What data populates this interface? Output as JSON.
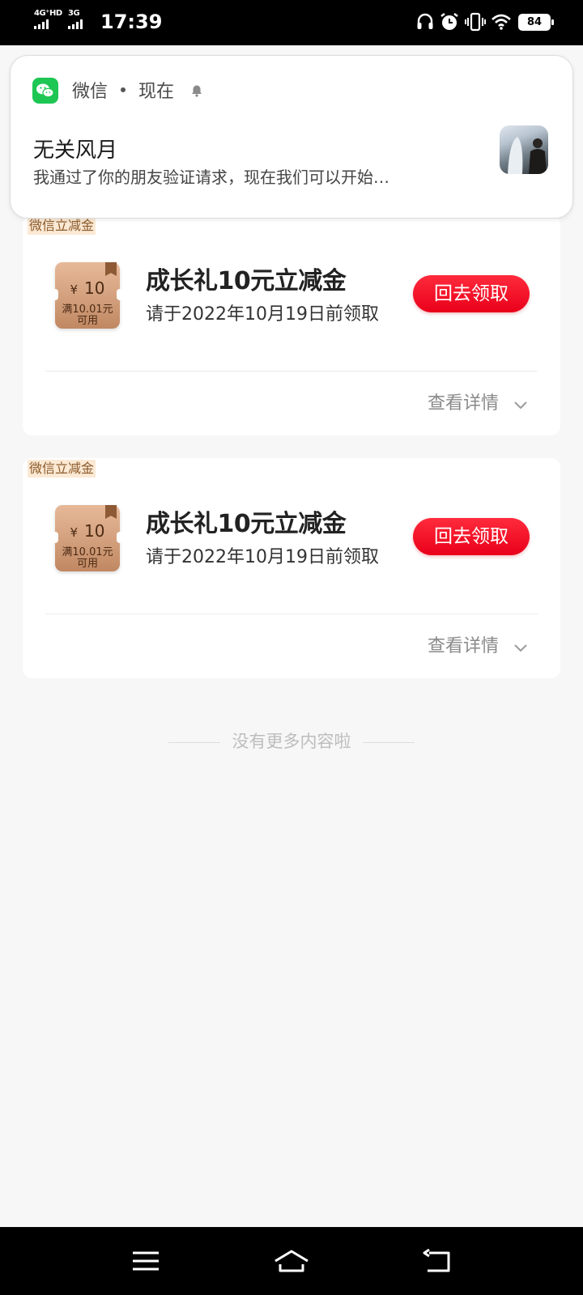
{
  "status_bar": {
    "time": "17:39",
    "network_1": "4G⁺HD",
    "network_2": "3G",
    "battery": "84",
    "icons": [
      "headphones-icon",
      "alarm-icon",
      "vibrate-icon",
      "wifi-icon",
      "battery-icon"
    ]
  },
  "notification": {
    "app_name": "微信",
    "time": "现在",
    "title": "无关风月",
    "text": "我通过了你的朋友验证请求，现在我们可以开始…"
  },
  "cards": [
    {
      "tag": "微信立减金",
      "coupon_currency": "¥",
      "coupon_amount": "10",
      "coupon_condition_1": "满10.01元",
      "coupon_condition_2": "可用",
      "title": "成长礼10元立减金",
      "subtitle": "请于2022年10月19日前领取",
      "button": "回去领取",
      "detail": "查看详情"
    },
    {
      "tag": "微信立减金",
      "coupon_currency": "¥",
      "coupon_amount": "10",
      "coupon_condition_1": "满10.01元",
      "coupon_condition_2": "可用",
      "title": "成长礼10元立减金",
      "subtitle": "请于2022年10月19日前领取",
      "button": "回去领取",
      "detail": "查看详情"
    }
  ],
  "footer_note": "没有更多内容啦",
  "nav": {
    "icons": [
      "menu-icon",
      "home-icon",
      "back-icon"
    ]
  },
  "colors": {
    "accent_red": "#f0061d",
    "wechat_green": "#1ec653",
    "coupon_gold": "#d29f7c"
  }
}
